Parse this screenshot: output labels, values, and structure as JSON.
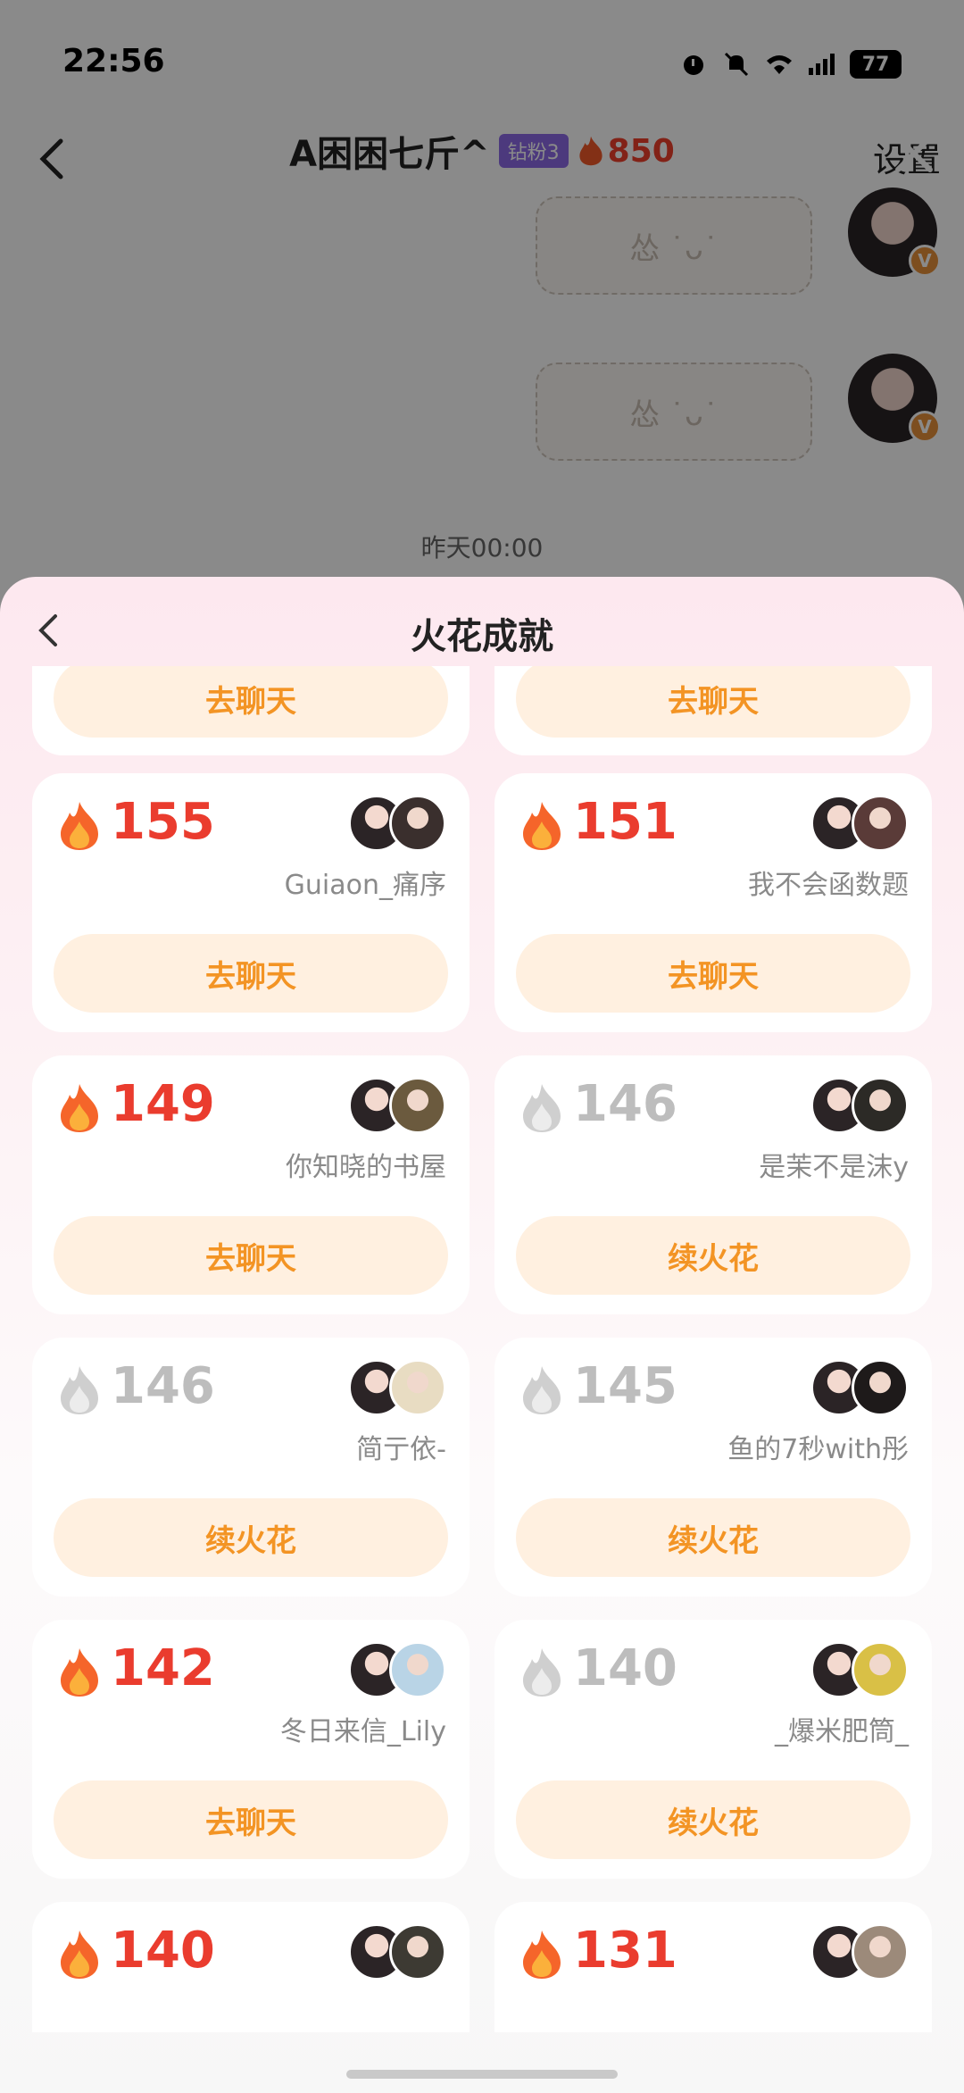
{
  "status_bar": {
    "time": "22:56",
    "battery": "77"
  },
  "chat_header": {
    "name": "A困困七斤^",
    "fan_badge": "钻粉3",
    "spark_count": "850",
    "settings_label": "设置"
  },
  "chat": {
    "timestamp": "昨天00:00",
    "sticker_text": "怂 ˙ᴗ˙"
  },
  "sheet": {
    "title": "火花成就"
  },
  "cards": [
    {
      "button": "去聊天"
    },
    {
      "button": "去聊天"
    },
    {
      "count": "155",
      "state": "hot",
      "nickname": "Guiaon_痛序",
      "button": "去聊天",
      "avatar2_color": "#3a2f2d"
    },
    {
      "count": "151",
      "state": "hot",
      "nickname": "我不会函数题",
      "button": "去聊天",
      "avatar2_color": "#5a3b38"
    },
    {
      "count": "149",
      "state": "hot",
      "nickname": "你知晓的书屋",
      "button": "去聊天",
      "avatar2_color": "#6b5a3e"
    },
    {
      "count": "146",
      "state": "cold",
      "nickname": "是茉不是沫y",
      "button": "续火花",
      "avatar2_color": "#2c2a26"
    },
    {
      "count": "146",
      "state": "cold",
      "nickname": "简亍依-",
      "button": "续火花",
      "avatar2_color": "#e8dcc2"
    },
    {
      "count": "145",
      "state": "cold",
      "nickname": "鱼的7秒with彤",
      "button": "续火花",
      "avatar2_color": "#1e1a1a"
    },
    {
      "count": "142",
      "state": "hot",
      "nickname": "冬日来信_Lily",
      "button": "去聊天",
      "avatar2_color": "#b9d4e6"
    },
    {
      "count": "140",
      "state": "cold",
      "nickname": "_爆米肥筒_",
      "button": "续火花",
      "avatar2_color": "#d9c046"
    },
    {
      "count": "140",
      "state": "hot",
      "nickname": "",
      "button": "",
      "avatar2_color": "#3d3a33"
    },
    {
      "count": "131",
      "state": "hot",
      "nickname": "",
      "button": "",
      "avatar2_color": "#9c8a7a"
    }
  ],
  "colors": {
    "hot": "#ea3c2e",
    "cold": "#bdbdbd",
    "button_text": "#f39424",
    "button_bg": "#fff0e0"
  }
}
